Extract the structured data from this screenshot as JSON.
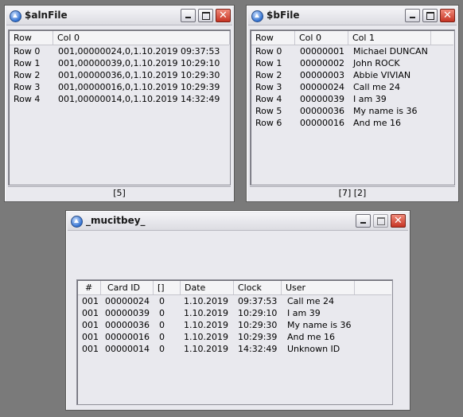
{
  "win_aln": {
    "title": "$alnFile",
    "headers": [
      "Row",
      "Col 0"
    ],
    "rows": [
      [
        "Row 0",
        "001,00000024,0,1.10.2019 09:37:53"
      ],
      [
        "Row 1",
        "001,00000039,0,1.10.2019 10:29:10"
      ],
      [
        "Row 2",
        "001,00000036,0,1.10.2019 10:29:30"
      ],
      [
        "Row 3",
        "001,00000016,0,1.10.2019 10:29:39"
      ],
      [
        "Row 4",
        "001,00000014,0,1.10.2019 14:32:49"
      ]
    ],
    "status": "[5]"
  },
  "win_b": {
    "title": "$bFile",
    "headers": [
      "Row",
      "Col 0",
      "Col 1"
    ],
    "rows": [
      [
        "Row 0",
        "00000001",
        "Michael DUNCAN"
      ],
      [
        "Row 1",
        "00000002",
        "John ROCK"
      ],
      [
        "Row 2",
        "00000003",
        "Abbie VIVIAN"
      ],
      [
        "Row 3",
        "00000024",
        "Call me 24"
      ],
      [
        "Row 4",
        "00000039",
        "I am 39"
      ],
      [
        "Row 5",
        "00000036",
        "My name is 36"
      ],
      [
        "Row 6",
        "00000016",
        "And me 16"
      ]
    ],
    "status": "[7] [2]"
  },
  "win_m": {
    "title": "_mucitbey_",
    "headers": [
      "#",
      "Card ID",
      "[]",
      "Date",
      "Clock",
      "User"
    ],
    "rows": [
      [
        "001",
        "00000024",
        "0",
        "1.10.2019",
        "09:37:53",
        "Call me 24"
      ],
      [
        "001",
        "00000039",
        "0",
        "1.10.2019",
        "10:29:10",
        "I am 39"
      ],
      [
        "001",
        "00000036",
        "0",
        "1.10.2019",
        "10:29:30",
        "My name is 36"
      ],
      [
        "001",
        "00000016",
        "0",
        "1.10.2019",
        "10:29:39",
        "And me 16"
      ],
      [
        "001",
        "00000014",
        "0",
        "1.10.2019",
        "14:32:49",
        "Unknown ID"
      ]
    ]
  },
  "icons": {
    "app": "app-logo-icon",
    "minimize": "minimize-icon",
    "maximize": "maximize-icon",
    "close": "close-icon",
    "close_glyph": "✕"
  },
  "colors": {
    "desktop": "#7a7a7a",
    "window": "#e9e9ee",
    "close_button": "#c63424"
  }
}
